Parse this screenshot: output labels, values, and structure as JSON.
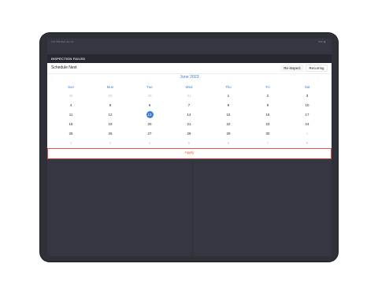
{
  "status_bar": {
    "left": "3:37 PM  Wed Jun 13",
    "right": "56% ▮"
  },
  "header": {
    "title": "INSPECTION FAILED"
  },
  "toolbar": {
    "title": "Schedule Next",
    "reinspect_label": "Re-Inspect",
    "recurring_label": "Recurring"
  },
  "calendar": {
    "month_label": "June 2023",
    "prev_icon": "‹",
    "next_icon": "›",
    "weekdays": [
      "Sun",
      "Mon",
      "Tue",
      "Wed",
      "Thu",
      "Fri",
      "Sat"
    ],
    "weeks": [
      [
        "28",
        "29",
        "30",
        "31",
        "1",
        "2",
        "3"
      ],
      [
        "4",
        "5",
        "6",
        "7",
        "8",
        "9",
        "10"
      ],
      [
        "11",
        "12",
        "13",
        "14",
        "15",
        "16",
        "17"
      ],
      [
        "18",
        "19",
        "20",
        "21",
        "22",
        "23",
        "24"
      ],
      [
        "25",
        "26",
        "27",
        "28",
        "29",
        "30",
        "1"
      ],
      [
        "2",
        "3",
        "4",
        "5",
        "6",
        "7",
        "8"
      ]
    ],
    "selected": "13"
  },
  "apply_label": "Apply",
  "colors": {
    "accent": "#3a7bd5",
    "danger": "#e25c4f",
    "header_bg": "#262930",
    "screen_bg": "#34373f"
  }
}
